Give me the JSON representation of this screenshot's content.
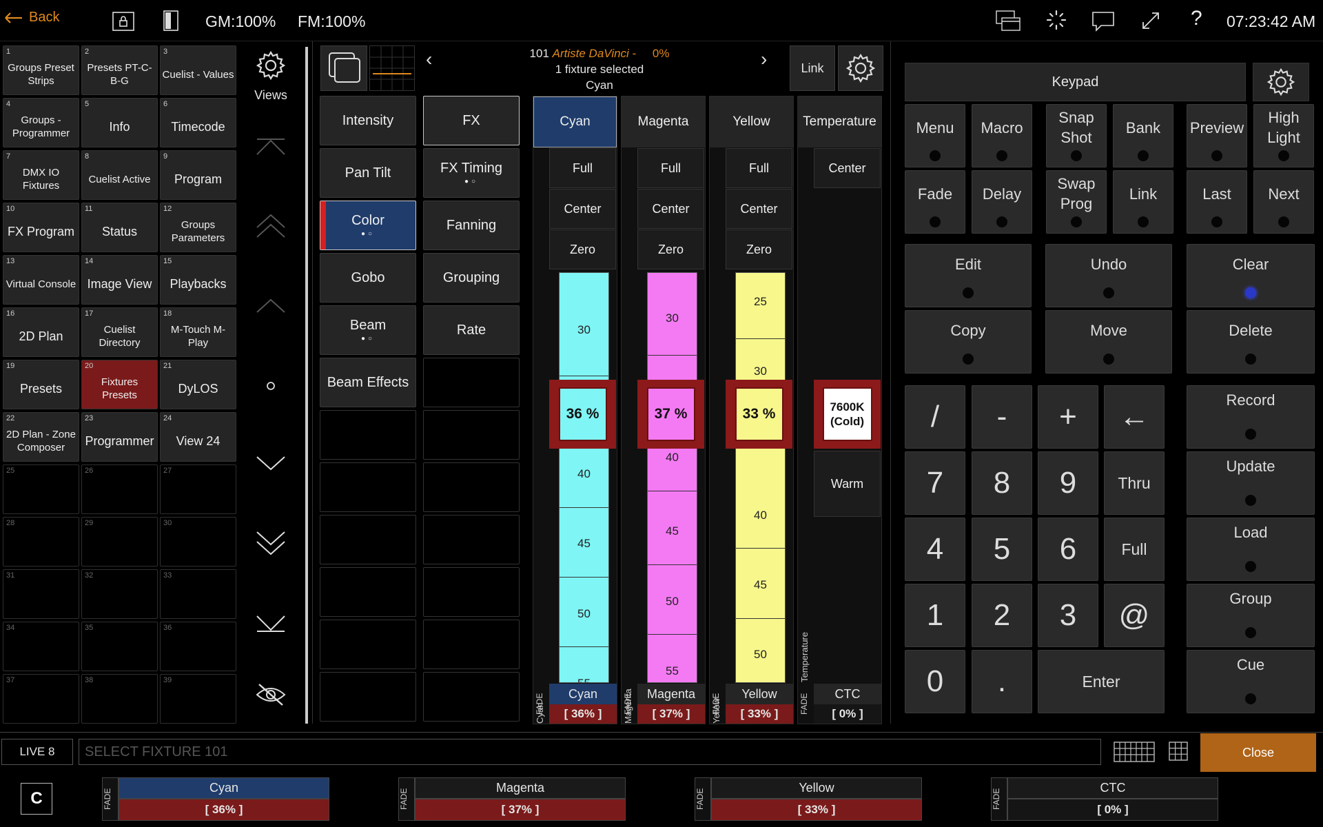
{
  "topbar": {
    "back_label": "Back",
    "gm": "GM:100%",
    "fm": "FM:100%",
    "time": "07:23:42 AM"
  },
  "views": {
    "settings_label": "Views",
    "tiles": [
      {
        "num": "1",
        "label": "Groups Preset Strips"
      },
      {
        "num": "2",
        "label": "Presets PT-C-B-G"
      },
      {
        "num": "3",
        "label": "Cuelist - Values"
      },
      {
        "num": "4",
        "label": "Groups - Programmer"
      },
      {
        "num": "5",
        "label": "Info"
      },
      {
        "num": "6",
        "label": "Timecode"
      },
      {
        "num": "7",
        "label": "DMX IO Fixtures"
      },
      {
        "num": "8",
        "label": "Cuelist Active"
      },
      {
        "num": "9",
        "label": "Program"
      },
      {
        "num": "10",
        "label": "FX Program"
      },
      {
        "num": "11",
        "label": "Status"
      },
      {
        "num": "12",
        "label": "Groups Parameters"
      },
      {
        "num": "13",
        "label": "Virtual Console"
      },
      {
        "num": "14",
        "label": "Image View"
      },
      {
        "num": "15",
        "label": "Playbacks"
      },
      {
        "num": "16",
        "label": "2D Plan"
      },
      {
        "num": "17",
        "label": "Cuelist Directory"
      },
      {
        "num": "18",
        "label": "M-Touch    M-Play"
      },
      {
        "num": "19",
        "label": "Presets"
      },
      {
        "num": "20",
        "label": "Fixtures Presets"
      },
      {
        "num": "21",
        "label": "DyLOS"
      },
      {
        "num": "22",
        "label": "2D Plan - Zone Composer"
      },
      {
        "num": "23",
        "label": "Programmer"
      },
      {
        "num": "24",
        "label": "View 24"
      },
      {
        "num": "25",
        "label": ""
      },
      {
        "num": "26",
        "label": ""
      },
      {
        "num": "27",
        "label": ""
      },
      {
        "num": "28",
        "label": ""
      },
      {
        "num": "29",
        "label": ""
      },
      {
        "num": "30",
        "label": ""
      },
      {
        "num": "31",
        "label": ""
      },
      {
        "num": "32",
        "label": ""
      },
      {
        "num": "33",
        "label": ""
      },
      {
        "num": "34",
        "label": ""
      },
      {
        "num": "35",
        "label": ""
      },
      {
        "num": "36",
        "label": ""
      },
      {
        "num": "37",
        "label": ""
      },
      {
        "num": "38",
        "label": ""
      },
      {
        "num": "39",
        "label": ""
      }
    ]
  },
  "fixture_header": {
    "number": "101",
    "name": "Artiste DaVinci",
    "dash": "-",
    "percent": "0%",
    "selected": "1 fixture selected",
    "attribute": "Cyan",
    "link_label": "Link"
  },
  "attributes": {
    "left": [
      "Intensity",
      "Pan Tilt",
      "Color",
      "Gobo",
      "Beam",
      "Beam Effects"
    ],
    "right": [
      "FX",
      "FX Timing",
      "Fanning",
      "Grouping",
      "Rate"
    ]
  },
  "faders": [
    {
      "name": "Cyan",
      "buttons": [
        "Full",
        "Center",
        "Zero"
      ],
      "ticks": [
        "30",
        "40",
        "45",
        "50",
        "55"
      ],
      "current": "36 %",
      "foot_value": "[ 36% ]",
      "fade": "FADE",
      "level": 0.36,
      "color": "#7ff5f5"
    },
    {
      "name": "Magenta",
      "buttons": [
        "Full",
        "Center",
        "Zero"
      ],
      "ticks": [
        "30",
        "40",
        "45",
        "50",
        "55"
      ],
      "current": "37 %",
      "foot_value": "[ 37% ]",
      "fade": "FADE",
      "level": 0.37,
      "color": "#f47af4"
    },
    {
      "name": "Yellow",
      "buttons": [
        "Full",
        "Center",
        "Zero"
      ],
      "ticks": [
        "25",
        "30",
        "40",
        "45",
        "50"
      ],
      "current": "33 %",
      "foot_value": "[ 33% ]",
      "fade": "FADE",
      "level": 0.33,
      "color": "#f7f78c"
    },
    {
      "name": "Temperature",
      "buttons": [
        "Center"
      ],
      "current": "7600K (Cold)",
      "warm": "Warm",
      "foot_name": "CTC",
      "foot_value": "[ 0% ]",
      "fade": "FADE"
    }
  ],
  "keypad": {
    "title": "Keypad",
    "function_keys": [
      "Menu",
      "Macro",
      "Snap Shot",
      "Bank",
      "Preview",
      "High Light",
      "Fade",
      "Delay",
      "Swap Prog",
      "Link",
      "Last",
      "Next"
    ],
    "edit_keys": [
      "Edit",
      "Undo",
      "Clear",
      "Copy",
      "Move",
      "Delete"
    ],
    "record_keys": [
      "Record",
      "Update",
      "Load",
      "Group",
      "Cue"
    ],
    "num_rows": [
      [
        "/",
        "-",
        "+",
        "←"
      ],
      [
        "7",
        "8",
        "9",
        "Thru"
      ],
      [
        "4",
        "5",
        "6",
        "Full"
      ],
      [
        "1",
        "2",
        "3",
        "@"
      ],
      [
        "0",
        ".",
        "Enter"
      ]
    ]
  },
  "command": {
    "mode": "LIVE 8",
    "placeholder": "SELECT FIXTURE 101",
    "close_label": "Close",
    "clear_label": "C"
  },
  "bottom_chips": [
    {
      "name": "Cyan",
      "value": "[ 36% ]",
      "fade": "FADE"
    },
    {
      "name": "Magenta",
      "value": "[ 37% ]",
      "fade": "FADE"
    },
    {
      "name": "Yellow",
      "value": "[ 33% ]",
      "fade": "FADE"
    },
    {
      "name": "CTC",
      "value": "[ 0% ]",
      "fade": "FADE"
    }
  ],
  "colors": {
    "accent": "#e08a1e",
    "selected": "#1f3c6b",
    "active_red": "#7a1a1a",
    "led_blue": "#2a38c8"
  }
}
